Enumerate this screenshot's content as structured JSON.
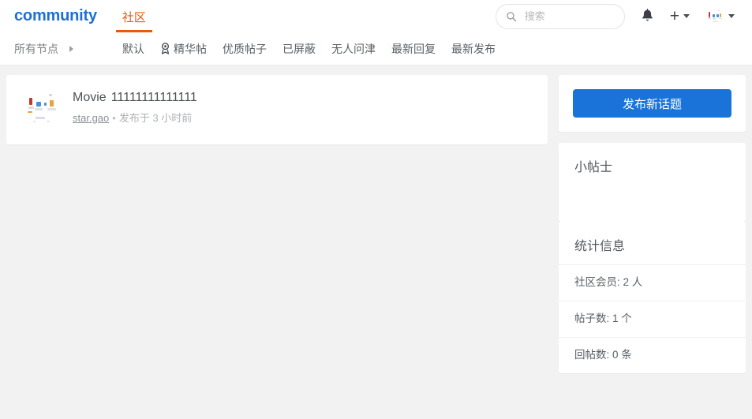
{
  "header": {
    "brand": "community",
    "tabs": [
      {
        "label": "社区",
        "active": true
      }
    ],
    "search": {
      "placeholder": "搜索",
      "value": "",
      "icon": "search-icon"
    },
    "notifications_icon": "bell-icon",
    "create_icon": "plus-icon",
    "avatar_icon": "user-avatar"
  },
  "subnav": {
    "all_nodes": "所有节点",
    "items": [
      {
        "label": "默认",
        "icon": null
      },
      {
        "label": "精华帖",
        "icon": "medal-icon"
      },
      {
        "label": "优质帖子",
        "icon": null
      },
      {
        "label": "已屏蔽",
        "icon": null
      },
      {
        "label": "无人问津",
        "icon": null
      },
      {
        "label": "最新回复",
        "icon": null
      },
      {
        "label": "最新发布",
        "icon": null
      }
    ]
  },
  "posts": [
    {
      "title_prefix": "Movie",
      "title": "11111111111111",
      "author": "star.gao",
      "separator": "•",
      "time": "发布于 3 小时前",
      "avatar_icon": "user-avatar"
    }
  ],
  "sidebar": {
    "new_topic_button": "发布新话题",
    "tips": {
      "heading": "小帖士",
      "body": ""
    },
    "stats": {
      "heading": "统计信息",
      "rows": [
        {
          "label": "社区会员: 2 人"
        },
        {
          "label": "帖子数: 1 个"
        },
        {
          "label": "回帖数: 0 条"
        }
      ]
    }
  },
  "colors": {
    "brand_blue": "#1f6fd6",
    "tab_orange": "#e8590c",
    "button_blue": "#1a73d9",
    "page_bg": "#f2f2f2",
    "card_bg": "#ffffff"
  }
}
